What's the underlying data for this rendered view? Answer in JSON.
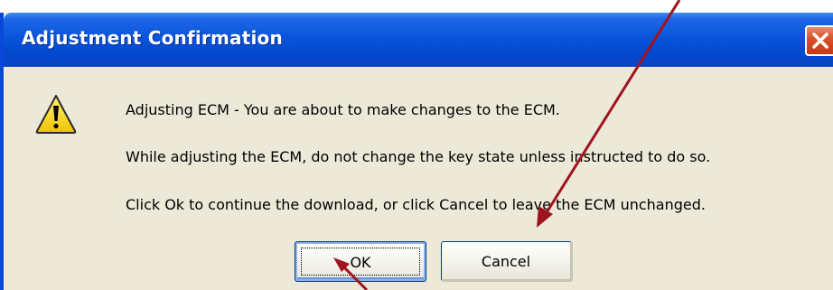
{
  "dialog": {
    "title": "Adjustment Confirmation",
    "close_icon": "close-x-icon",
    "message_icon": "warning-icon",
    "messages": [
      "Adjusting ECM - You are about to make changes to the ECM.",
      "While adjusting the ECM, do not change the key state unless instructed to do so.",
      "Click Ok to continue the download, or click Cancel to leave the ECM unchanged."
    ],
    "buttons": {
      "ok": "OK",
      "cancel": "Cancel"
    }
  },
  "colors": {
    "titlebar": "#0a55db",
    "dialog_background": "#ece9d8",
    "close_button": "#d9522d",
    "annotation_arrow": "#a0141e"
  }
}
